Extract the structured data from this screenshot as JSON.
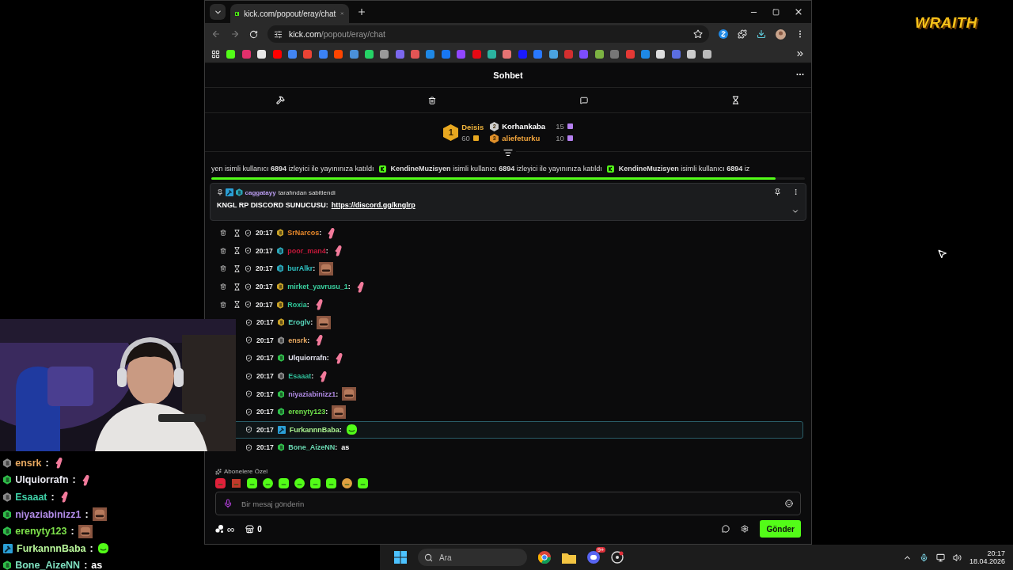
{
  "desktop": {
    "logo": "WRAITH"
  },
  "browser": {
    "tab_title": "kick.com/popout/eray/chat",
    "url_host": "kick.com",
    "url_path": "/popout/eray/chat"
  },
  "chat": {
    "title": "Sohbet",
    "leaderboard": [
      {
        "rank": "1",
        "name": "Deisis",
        "count": "60",
        "color": "#f0b43c"
      },
      {
        "rank": "2",
        "name": "Korhankaba",
        "count": "15",
        "color": "#ffffff"
      },
      {
        "rank": "3",
        "name": "aliefeturku",
        "count": "10",
        "color": "#f0a43c"
      }
    ],
    "ticker": {
      "segments": [
        "yen isimli kullanıcı **6894** izleyici ile yayınınıza katıldı",
        "**KendineMuzisyen** isimli kullanıcı **6894** izleyici ile yayınınıza katıldı",
        "**KendineMuzisyen** isimli kullanıcı **6894** iz"
      ],
      "level": 0.95
    },
    "pinned": {
      "user": "caggatayy",
      "suffix": "tarafından sabitlendi",
      "message": "KNGL RP DISCORD SUNUCUSU:",
      "link": "https://discord.gg/knglrp"
    },
    "messages": [
      {
        "time": "20:17",
        "name": "SrNarcos",
        "separator": ":",
        "color": "#e8892b",
        "badge": {
          "kind": "sub",
          "color": "#c9a227"
        },
        "mod_icons": true,
        "kind": "hand",
        "selected": false
      },
      {
        "time": "20:17",
        "name": "poor_man4",
        "separator": ":",
        "color": "#c4183a",
        "badge": {
          "kind": "sub",
          "color": "#2aa6b8"
        },
        "mod_icons": true,
        "kind": "hand",
        "selected": false
      },
      {
        "time": "20:17",
        "name": "burAlkr",
        "separator": ":",
        "color": "#2ec4c4",
        "badge": {
          "kind": "sub",
          "color": "#2aa6b8"
        },
        "mod_icons": true,
        "selected": false
      },
      {
        "time": "20:17",
        "name": "mirket_yavrusu_1",
        "separator": ":",
        "color": "#3ad1a0",
        "badge": {
          "kind": "sub",
          "color": "#c9a227"
        },
        "mod_icons": true,
        "kind": "hand",
        "selected": false
      },
      {
        "time": "20:17",
        "name": "Roxia",
        "separator": ":",
        "color": "#2fc99a",
        "badge": {
          "kind": "sub",
          "color": "#c9a227"
        },
        "mod_icons": true,
        "kind": "hand",
        "selected": false
      },
      {
        "time": "20:17",
        "name": "Eroglv",
        "separator": ":",
        "color": "#56d3b8",
        "badge": {
          "kind": "sub",
          "color": "#c9a227"
        },
        "mod_icons": false,
        "selected": false
      },
      {
        "time": "20:17",
        "name": "ensrk",
        "separator": ":",
        "color": "#e7a860",
        "badge": {
          "kind": "sub",
          "color": "#8a8a8a"
        },
        "mod_icons": false,
        "kind": "hand",
        "selected": false
      },
      {
        "time": "20:17",
        "name": "Ulquiorrafn",
        "separator": ":",
        "color": "#e2e2ee",
        "badge": {
          "kind": "sub",
          "color": "#2fbf4a"
        },
        "mod_icons": false,
        "kind": "hand",
        "selected": false
      },
      {
        "time": "20:17",
        "name": "Esaaat",
        "separator": ":",
        "color": "#2fbf9a",
        "badge": {
          "kind": "sub",
          "color": "#8a8a8a"
        },
        "mod_icons": false,
        "kind": "hand",
        "selected": false
      },
      {
        "time": "20:17",
        "name": "niyaziabinizz1",
        "separator": ":",
        "color": "#b18be6",
        "badge": {
          "kind": "sub",
          "color": "#2fbf4a"
        },
        "mod_icons": false,
        "selected": false
      },
      {
        "time": "20:17",
        "name": "erenyty123",
        "separator": ":",
        "color": "#6fe04a",
        "badge": {
          "kind": "sub",
          "color": "#2fbf4a"
        },
        "mod_icons": false,
        "selected": false
      },
      {
        "time": "20:17",
        "name": "FurkannnBaba",
        "separator": ":",
        "color": "#a8f08e",
        "badge": {
          "kind": "mod",
          "color": "#2b9fd6"
        },
        "mod_icons": false,
        "kind": "blob",
        "selected": true
      },
      {
        "time": "20:17",
        "name": "Bone_AizeNN",
        "separator": ":",
        "color": "#69d6b0",
        "badge": {
          "kind": "sub",
          "color": "#2fbf4a"
        },
        "mod_icons": false,
        "kind": "text",
        "text": "as",
        "selected": false
      }
    ],
    "emote_section": "Abonelere Özel",
    "input": {
      "placeholder": "Bir mesaj gönderin"
    },
    "points": "∞",
    "store_count": "0",
    "send": "Gönder"
  },
  "overlay_chat": [
    {
      "name": "ensrk",
      "separator": ":",
      "color": "#e7a860",
      "badge": {
        "kind": "sub",
        "color": "#8a8a8a"
      },
      "kind": "hand"
    },
    {
      "name": "Ulquiorrafn",
      "separator": ":",
      "color": "#e8e8f0",
      "badge": {
        "kind": "sub",
        "color": "#2fbf4a"
      },
      "kind": "hand"
    },
    {
      "name": "Esaaat",
      "separator": ":",
      "color": "#3fd1a8",
      "badge": {
        "kind": "sub",
        "color": "#8a8a8a"
      },
      "kind": "hand"
    },
    {
      "name": "niyaziabinizz1",
      "separator": ":",
      "color": "#b18be6",
      "badge": {
        "kind": "sub",
        "color": "#2fbf4a"
      }
    },
    {
      "name": "erenyty123",
      "separator": ":",
      "color": "#7de04a",
      "badge": {
        "kind": "sub",
        "color": "#2fbf4a"
      }
    },
    {
      "name": "FurkannnBaba",
      "separator": ":",
      "color": "#b8f59a",
      "badge": {
        "kind": "mod",
        "color": "#2b9fd6"
      },
      "kind": "blob"
    },
    {
      "name": "Bone_AizeNN",
      "separator": ":",
      "color": "#7fe0c0",
      "badge": {
        "kind": "sub",
        "color": "#2fbf4a"
      },
      "kind": "text",
      "text": "as"
    }
  ],
  "taskbar": {
    "search": "Ara",
    "discord_badge": "9+",
    "time": "20:17",
    "date": "18.04.2026"
  }
}
